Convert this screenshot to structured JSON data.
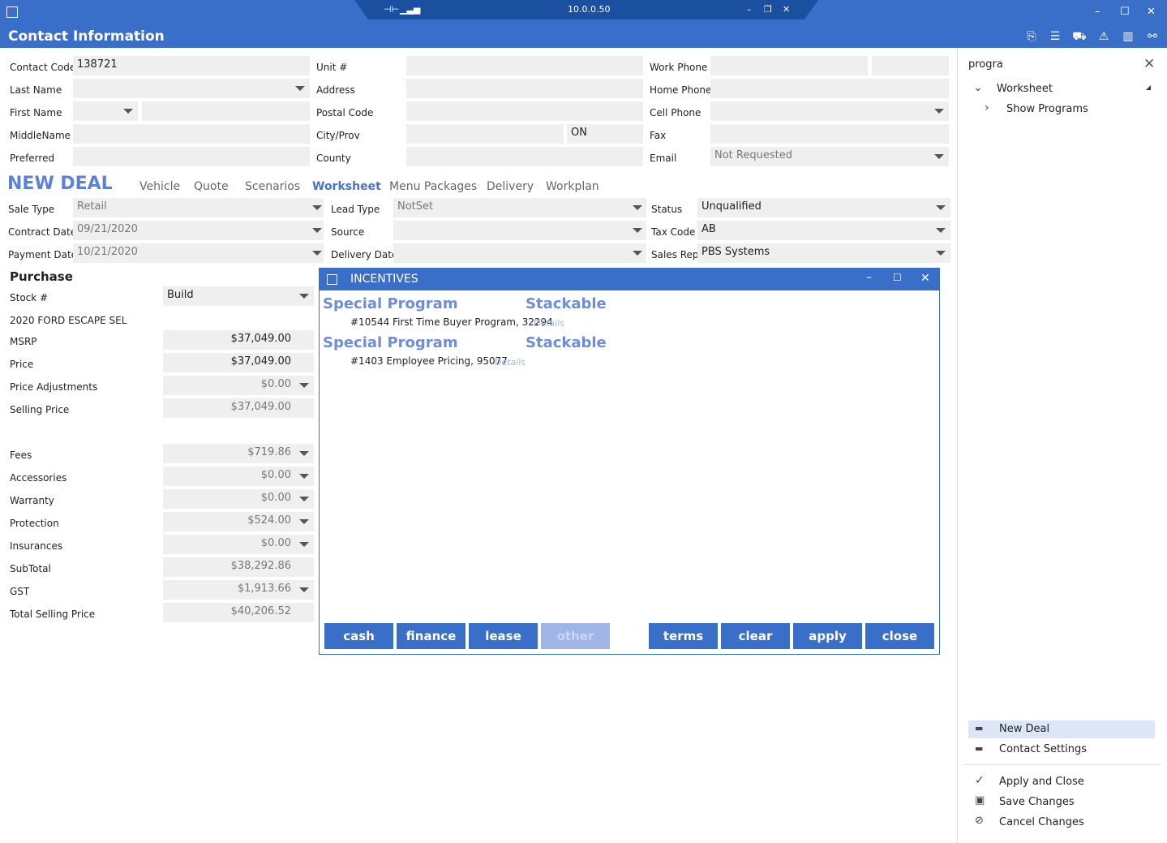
{
  "titlebar": {
    "ip": "10.0.0.50"
  },
  "header": {
    "title": "Contact Information"
  },
  "contact": {
    "contact_code_label": "Contact Code",
    "contact_code": "138721",
    "last_name_label": "Last Name",
    "first_name_label": "First Name",
    "middle_name_label": "MiddleName",
    "preferred_label": "Preferred",
    "unit_label": "Unit #",
    "address_label": "Address",
    "postal_label": "Postal Code",
    "city_label": "City/Prov",
    "province": "ON",
    "county_label": "County",
    "work_phone_label": "Work Phone",
    "home_phone_label": "Home Phone",
    "cell_phone_label": "Cell Phone",
    "fax_label": "Fax",
    "email_label": "Email",
    "email_value": "Not Requested"
  },
  "deal": {
    "title": "NEW DEAL",
    "tabs": [
      "Vehicle",
      "Quote",
      "Scenarios",
      "Worksheet",
      "Menu Packages",
      "Delivery",
      "Workplan"
    ],
    "sale_type_label": "Sale Type",
    "sale_type": "Retail",
    "contract_date_label": "Contract Date",
    "contract_date": "09/21/2020",
    "payment_date_label": "Payment Date",
    "payment_date": "10/21/2020",
    "lead_type_label": "Lead Type",
    "lead_type": "NotSet",
    "source_label": "Source",
    "delivery_date_label": "Delivery Date",
    "status_label": "Status",
    "status": "Unqualified",
    "tax_code_label": "Tax Code",
    "tax_code": "AB",
    "sales_rep_label": "Sales Rep",
    "sales_rep": "PBS Systems"
  },
  "purchase": {
    "title": "Purchase",
    "stock_label": "Stock #",
    "stock_value": "Build",
    "vehicle": "2020 FORD ESCAPE SEL",
    "msrp_label": "MSRP",
    "msrp": "$37,049.00",
    "price_label": "Price",
    "price": "$37,049.00",
    "price_adj_label": "Price Adjustments",
    "price_adj": "$0.00",
    "selling_price_label": "Selling Price",
    "selling_price": "$37,049.00",
    "fees_label": "Fees",
    "fees": "$719.86",
    "accessories_label": "Accessories",
    "accessories": "$0.00",
    "warranty_label": "Warranty",
    "warranty": "$0.00",
    "protection_label": "Protection",
    "protection": "$524.00",
    "insurances_label": "Insurances",
    "insurances": "$0.00",
    "subtotal_label": "SubTotal",
    "subtotal": "$38,292.86",
    "gst_label": "GST",
    "gst": "$1,913.66",
    "total_label": "Total Selling Price",
    "total": "$40,206.52"
  },
  "incentives": {
    "title": "INCENTIVES",
    "programs": [
      {
        "type": "Special Program",
        "stack": "Stackable",
        "line": "#10544 First Time Buyer Program, 32294",
        "details": "Details"
      },
      {
        "type": "Special Program",
        "stack": "Stackable",
        "line": "#1403 Employee Pricing, 95077",
        "details": "Details"
      }
    ],
    "buttons": {
      "cash": "cash",
      "finance": "finance",
      "lease": "lease",
      "other": "other",
      "terms": "terms",
      "clear": "clear",
      "apply": "apply",
      "close": "close"
    }
  },
  "right_panel": {
    "search_value": "progra",
    "tree_root": "Worksheet",
    "tree_child": "Show Programs",
    "menu": [
      "New Deal",
      "Contact Settings"
    ],
    "actions": [
      "Apply and Close",
      "Save Changes",
      "Cancel Changes"
    ]
  }
}
